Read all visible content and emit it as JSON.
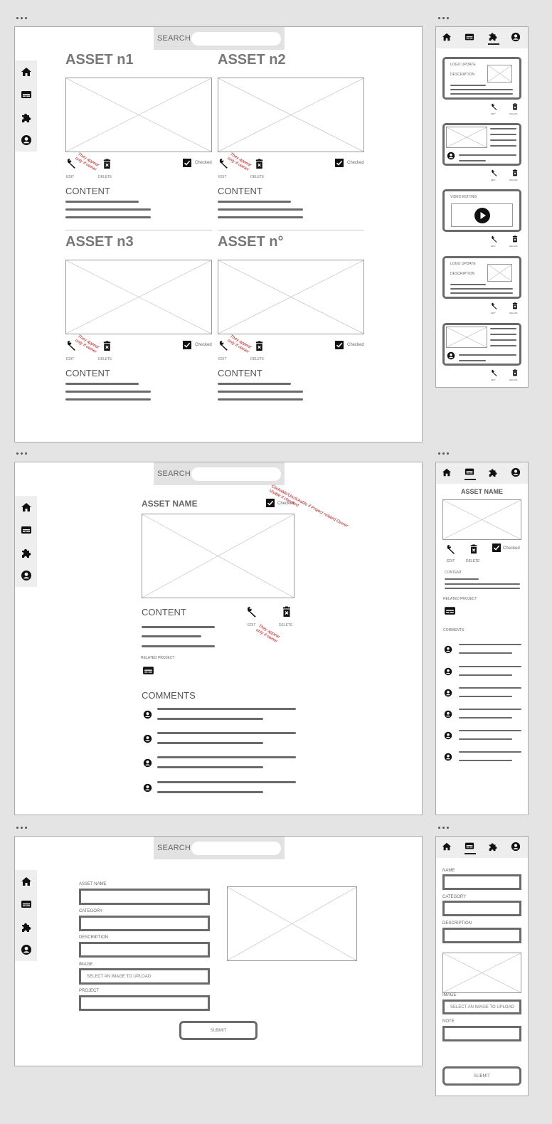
{
  "search_label": "SEARCH",
  "screen1": {
    "assets": [
      {
        "title": "ASSET n1",
        "edit": "EDIT",
        "delete": "DELETE",
        "checked": "Checked",
        "annotation": "They appear\nonly if owner",
        "content": "CONTENT"
      },
      {
        "title": "ASSET n2",
        "edit": "EDIT",
        "delete": "DELETE",
        "checked": "Checked",
        "annotation": "They appear\nonly if owner",
        "content": "CONTENT"
      },
      {
        "title": "ASSET n3",
        "edit": "EDIT",
        "delete": "DELETE",
        "checked": "Checked",
        "annotation": "They appear\nonly if owner",
        "content": "CONTENT"
      },
      {
        "title": "ASSET n°",
        "edit": "EDIT",
        "delete": "DELETE",
        "checked": "Checked",
        "annotation": "They appear\nonly if owner",
        "content": "CONTENT"
      }
    ]
  },
  "mobile1": {
    "cards": [
      {
        "line1": "LOGO UPDATE",
        "line2": "DESCRIPTION",
        "edit": "EDIT",
        "delete": "DELETE"
      },
      {
        "edit": "EDIT",
        "delete": "DELETE"
      },
      {
        "line1": "VIDEO EDITING",
        "edit": "EDIT",
        "delete": "DELETE"
      },
      {
        "line1": "LOGO UPDATE",
        "line2": "DESCRIPTION",
        "edit": "EDIT",
        "delete": "DELETE"
      },
      {
        "edit": "EDIT",
        "delete": "DELETE"
      }
    ]
  },
  "screen2": {
    "asset_name": "ASSET NAME",
    "checked": "Checked",
    "annotation_check": "Clickable/Unclickable if Project related Owner\nVisible if checked",
    "content": "CONTENT",
    "edit": "EDIT",
    "delete": "DELETE",
    "annotation_owner": "They appear\nonly if owner",
    "related_project": "RELATED PROJECT",
    "comments": "COMMENTS"
  },
  "mobile2": {
    "asset_name": "ASSET NAME",
    "edit": "EDIT",
    "delete": "DELETE",
    "checked": "Checked",
    "content": "CONTENT",
    "related_project": "RELATED PROJECT",
    "comments": "COMMENTS"
  },
  "screen3": {
    "asset_name": "ASSET NAME",
    "category": "CATEGORY",
    "description": "DESCRIPTION",
    "image": "IMAGE",
    "image_placeholder": "SELECT AN IMAGE TO UPLOAD",
    "project": "PROJECT",
    "submit": "SUBMIT"
  },
  "mobile3": {
    "name": "NAME",
    "category": "CATEGORY",
    "description": "DESCRIPTION",
    "image": "IMAGE",
    "image_placeholder": "SELECT AN IMAGE TO UPLOAD",
    "note": "NOTE",
    "submit": "SUBMIT"
  }
}
